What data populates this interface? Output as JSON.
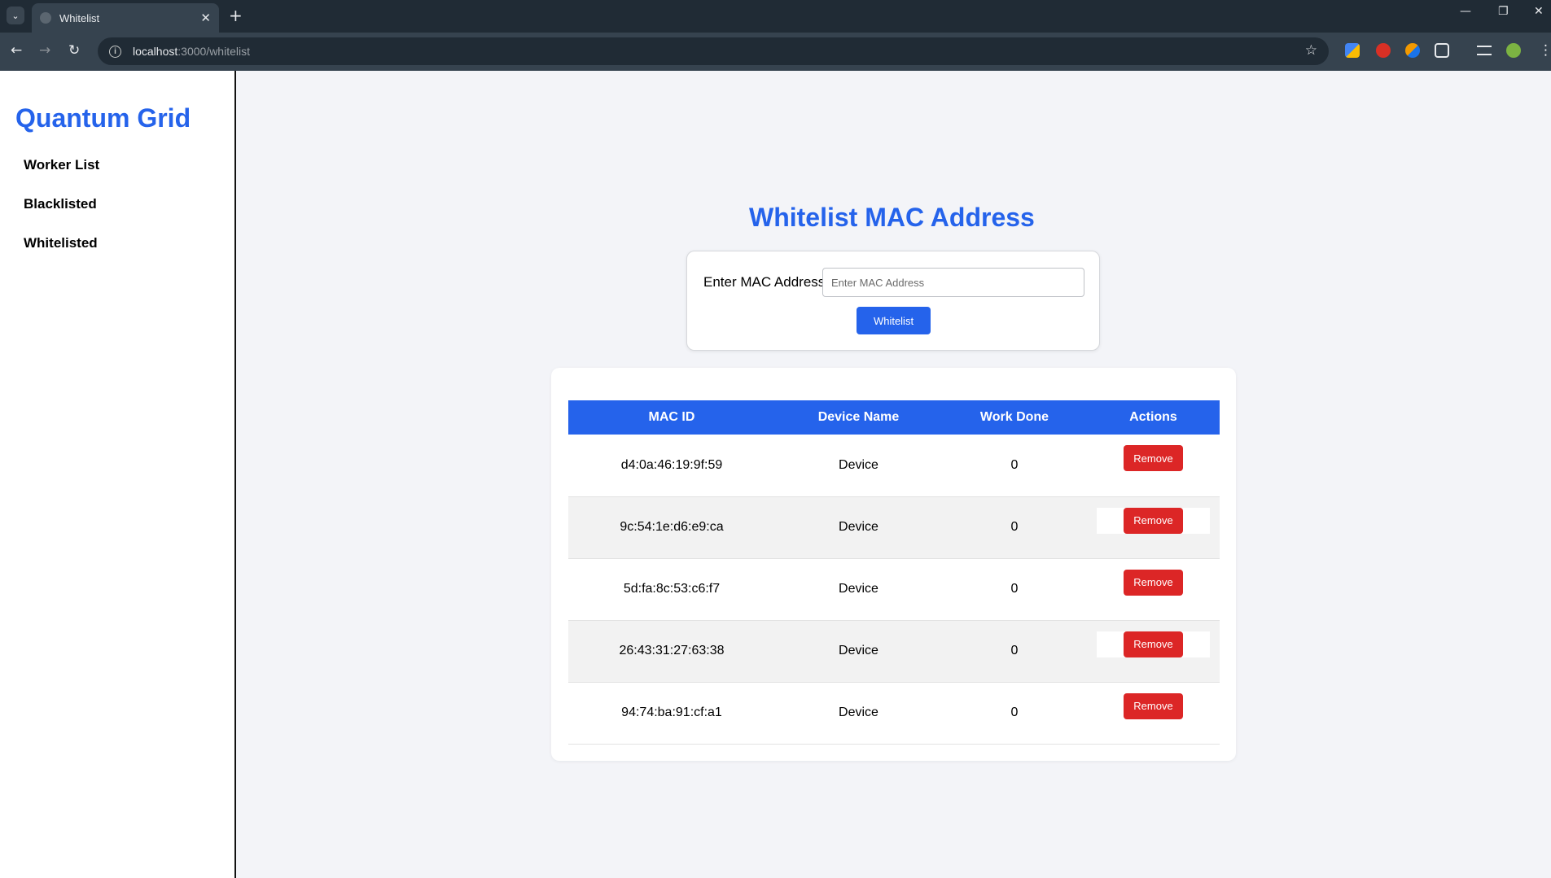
{
  "browser": {
    "tab_title": "Whitelist",
    "url_host": "localhost",
    "url_path": ":3000/whitelist",
    "new_tab": "+",
    "close_tab": "✕",
    "minimize": "—",
    "maximize": "❐",
    "close_window": "✕"
  },
  "sidebar": {
    "brand": "Quantum Grid",
    "items": [
      {
        "label": "Worker List"
      },
      {
        "label": "Blacklisted"
      },
      {
        "label": "Whitelisted"
      }
    ]
  },
  "main": {
    "title": "Whitelist MAC Address",
    "form": {
      "label": "Enter MAC Address",
      "placeholder": "Enter MAC Address",
      "value": "",
      "button_label": "Whitelist"
    },
    "table": {
      "headers": [
        "MAC ID",
        "Device Name",
        "Work Done",
        "Actions"
      ],
      "rows": [
        {
          "mac": "d4:0a:46:19:9f:59",
          "device": "Device",
          "work": "0",
          "action": "Remove"
        },
        {
          "mac": "9c:54:1e:d6:e9:ca",
          "device": "Device",
          "work": "0",
          "action": "Remove"
        },
        {
          "mac": "5d:fa:8c:53:c6:f7",
          "device": "Device",
          "work": "0",
          "action": "Remove"
        },
        {
          "mac": "26:43:31:27:63:38",
          "device": "Device",
          "work": "0",
          "action": "Remove"
        },
        {
          "mac": "94:74:ba:91:cf:a1",
          "device": "Device",
          "work": "0",
          "action": "Remove"
        }
      ]
    }
  },
  "colors": {
    "accent": "#2563eb",
    "danger": "#dc2626",
    "background": "#f3f4f8"
  }
}
